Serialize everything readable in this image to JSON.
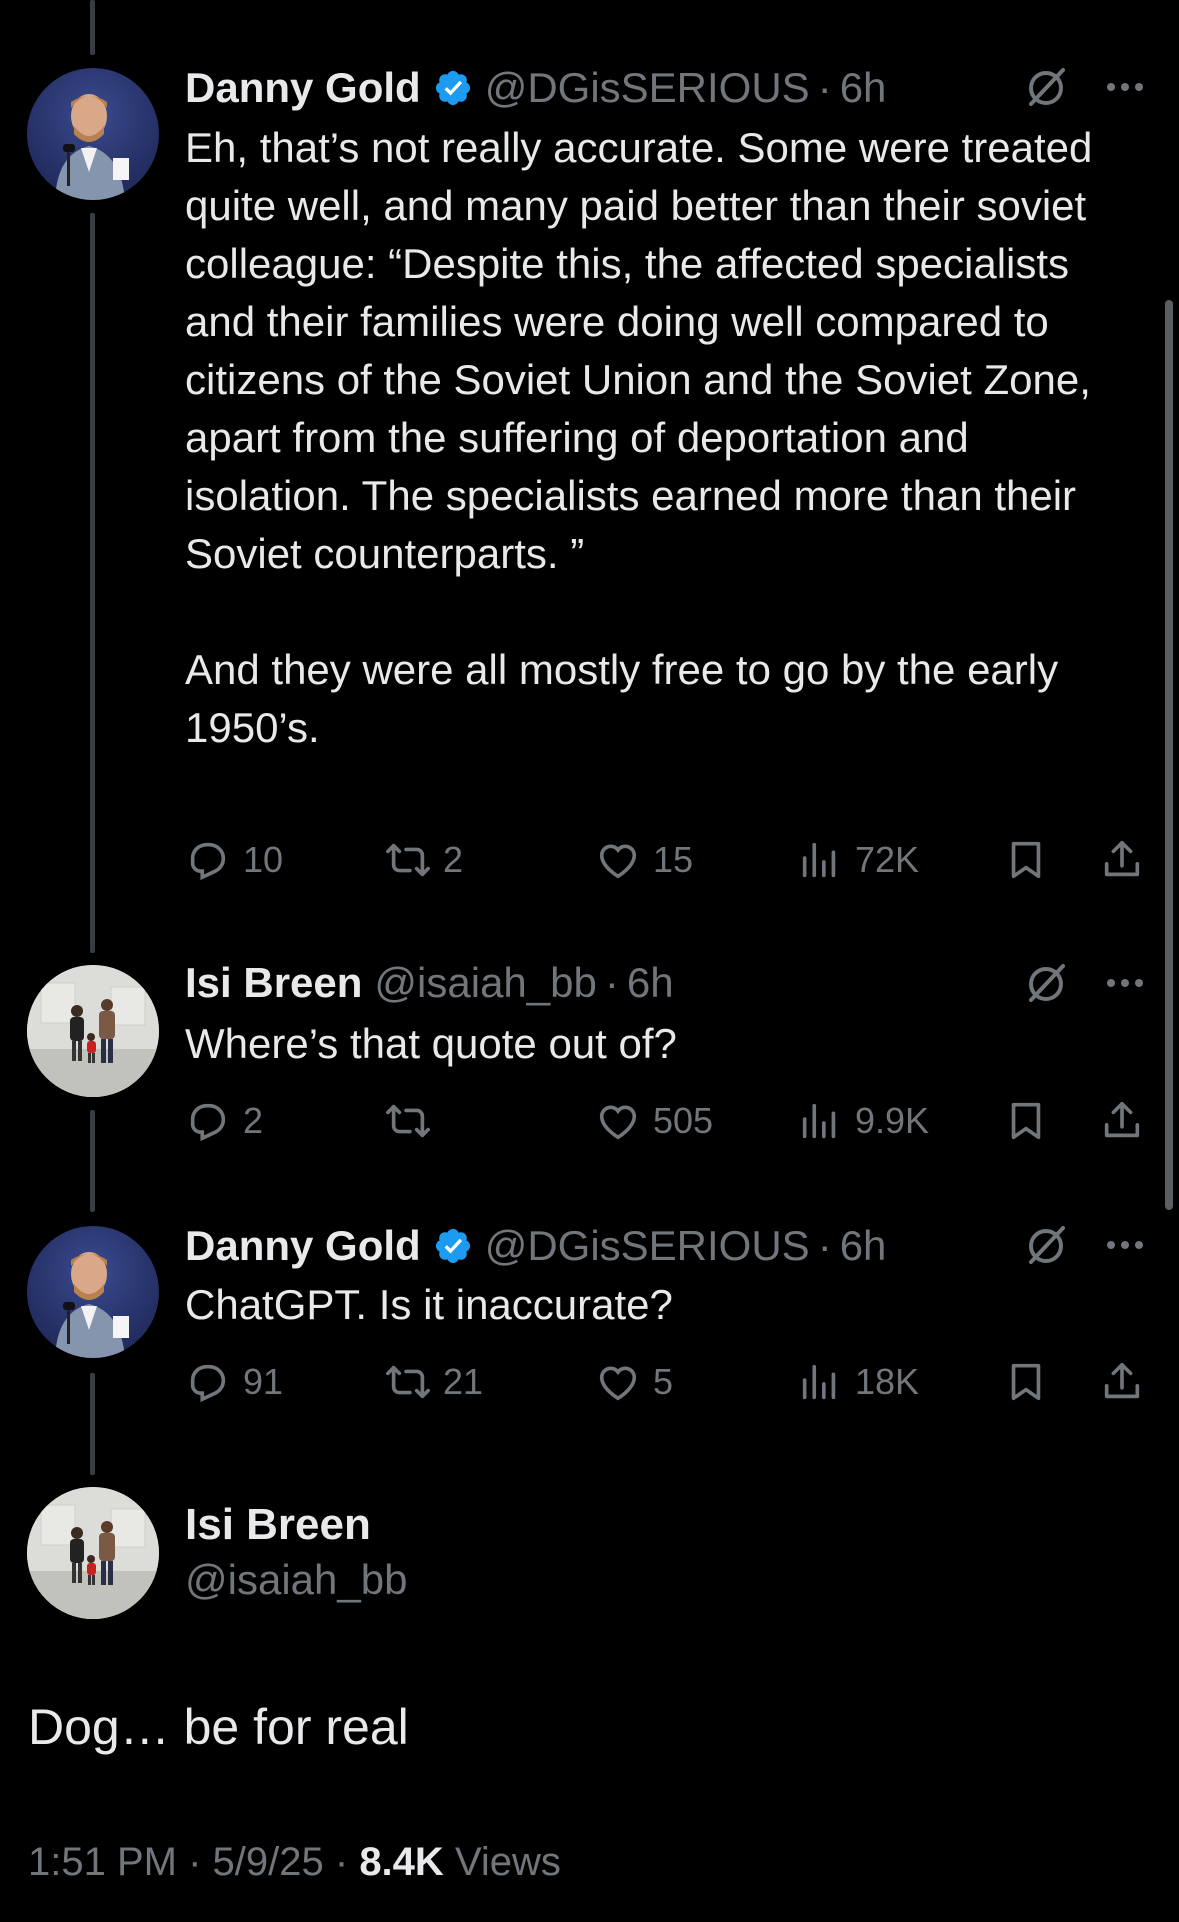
{
  "tweets": [
    {
      "name": "Danny Gold",
      "handle": "@DGisSERIOUS",
      "time": "6h",
      "verified": true,
      "text": "Eh, that’s not really accurate. Some were treated quite well, and many paid better than their soviet colleague: “Despite this, the affected specialists and their families were doing well compared to citizens of the Soviet Union and the Soviet Zone, apart from the suffering of deportation and isolation. The specialists earned more than their Soviet counterparts. ”\n\nAnd they were all mostly free to go by the early 1950’s.",
      "replies": "10",
      "reposts": "2",
      "likes": "15",
      "views": "72K"
    },
    {
      "name": "Isi Breen",
      "handle": "@isaiah_bb",
      "time": "6h",
      "verified": false,
      "text": "Where’s that quote out of?",
      "replies": "2",
      "reposts": "",
      "likes": "505",
      "views": "9.9K"
    },
    {
      "name": "Danny Gold",
      "handle": "@DGisSERIOUS",
      "time": "6h",
      "verified": true,
      "text": "ChatGPT. Is it inaccurate?",
      "replies": "91",
      "reposts": "21",
      "likes": "5",
      "views": "18K"
    }
  ],
  "main_tweet": {
    "name": "Isi Breen",
    "handle": "@isaiah_bb",
    "text": "Dog… be for real",
    "time": "1:51 PM",
    "date": "5/9/25",
    "views_count": "8.4K",
    "views_label": "Views"
  },
  "colors": {
    "background": "#000000",
    "text": "#e7e9ea",
    "muted": "#71767b",
    "verified": "#1d9bf0"
  },
  "icons": [
    "reply-icon",
    "repost-icon",
    "like-icon",
    "views-icon",
    "bookmark-icon",
    "share-icon",
    "grok-icon",
    "more-icon",
    "verified-badge-icon"
  ]
}
